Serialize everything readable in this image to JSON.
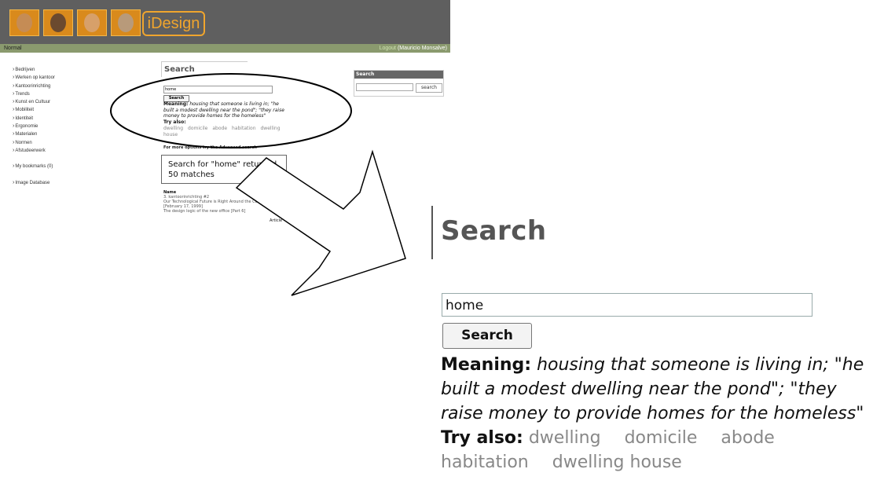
{
  "app": {
    "brand": "iDesign",
    "mode": "Normal",
    "logout_label": "Logout",
    "user_name": "(Mauricio Monsalve)"
  },
  "sidebar": {
    "items": [
      {
        "label": "Bedrijven"
      },
      {
        "label": "Werken op kantoor"
      },
      {
        "label": "Kantoorinrichting"
      },
      {
        "label": "Trends"
      },
      {
        "label": "Kunst en Cultuur"
      },
      {
        "label": "Mobiliteit"
      },
      {
        "label": "Identiteit"
      },
      {
        "label": "Ergonomie"
      },
      {
        "label": "Materialen"
      },
      {
        "label": "Normen"
      },
      {
        "label": "Afstudeerwerk"
      }
    ],
    "bookmarks": "My bookmarks (0)",
    "image_database": "Image Database"
  },
  "search": {
    "title": "Search",
    "query": "home",
    "button": "Search",
    "meaning_label": "Meaning:",
    "meaning_text": "housing that someone is living in; \"he built a modest dwelling near the pond\"; \"they raise money to provide homes for the homeless\"",
    "try_label": "Try also:",
    "try_terms": [
      "dwelling",
      "domicile",
      "abode",
      "habitation",
      "dwelling house"
    ],
    "advanced_text": "For more options try the Advanced search",
    "result_text": "Search for \"home\" returned 50 matches"
  },
  "results": {
    "header": "Name",
    "items": [
      "3. kantoorinrichting #2",
      "Our Technological Future is Right Around the Corner [February 17, 1999]",
      "The design logic of the new office [Part 6]"
    ],
    "type_label": "Article"
  },
  "right_search": {
    "title": "Search",
    "button": "search"
  },
  "colors": {
    "header_bg": "#5f5f5f",
    "status_bar": "#8a9a6e",
    "brand_orange": "#f0a52d",
    "link_gray": "#888888"
  }
}
